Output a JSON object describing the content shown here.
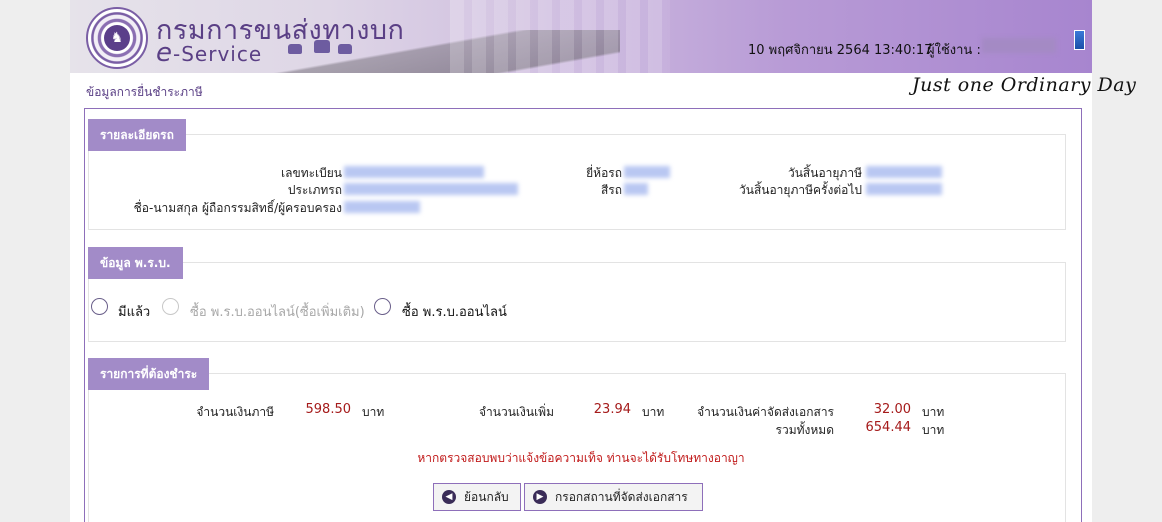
{
  "header": {
    "department_title": "กรมการขนส่งทางบก",
    "eservice_e": "e",
    "eservice_rest": "-Service",
    "datetime": "10 พฤศจิกายน 2564 13:40:17",
    "user_label": "ผู้ใช้งาน :"
  },
  "breadcrumb": "ข้อมูลการยื่นชำระภาษี",
  "watermark": "Just one Ordinary Day",
  "vehicle_details": {
    "heading": "รายละเอียดรถ",
    "labels": {
      "plate": "เลขทะเบียน",
      "type": "ประเภทรถ",
      "owner": "ชื่อ-นามสกุล ผู้ถือกรรมสิทธิ์/ผู้ครอบครอง",
      "brand": "ยี่ห้อรถ",
      "color": "สีรถ",
      "tax_expiry": "วันสิ้นอายุภาษี",
      "next_tax_expiry": "วันสิ้นอายุภาษีครั้งต่อไป"
    }
  },
  "insurance": {
    "heading": "ข้อมูล พ.ร.บ.",
    "options": [
      {
        "label": "มีแล้ว",
        "disabled": false
      },
      {
        "label": "ซื้อ พ.ร.บ.ออนไลน์(ซื้อเพิ่มเติม)",
        "disabled": true
      },
      {
        "label": "ซื้อ พ.ร.บ.ออนไลน์",
        "disabled": false
      }
    ]
  },
  "payment": {
    "heading": "รายการที่ต้องชำระ",
    "tax_label": "จำนวนเงินภาษี",
    "tax_amount": "598.50",
    "surcharge_label": "จำนวนเงินเพิ่ม",
    "surcharge_amount": "23.94",
    "delivery_label": "จำนวนเงินค่าจัดส่งเอกสาร",
    "delivery_amount": "32.00",
    "total_label": "รวมทั้งหมด",
    "total_amount": "654.44",
    "currency": "บาท"
  },
  "warning": "หากตรวจสอบพบว่าแจ้งข้อความเท็จ ท่านจะได้รับโทษทางอาญา",
  "buttons": {
    "back": "ย้อนกลับ",
    "next": "กรอกสถานที่จัดส่งเอกสาร"
  },
  "colors": {
    "accent": "#a28bc8",
    "amount": "#a51b1b",
    "warning": "#c11b1b"
  }
}
